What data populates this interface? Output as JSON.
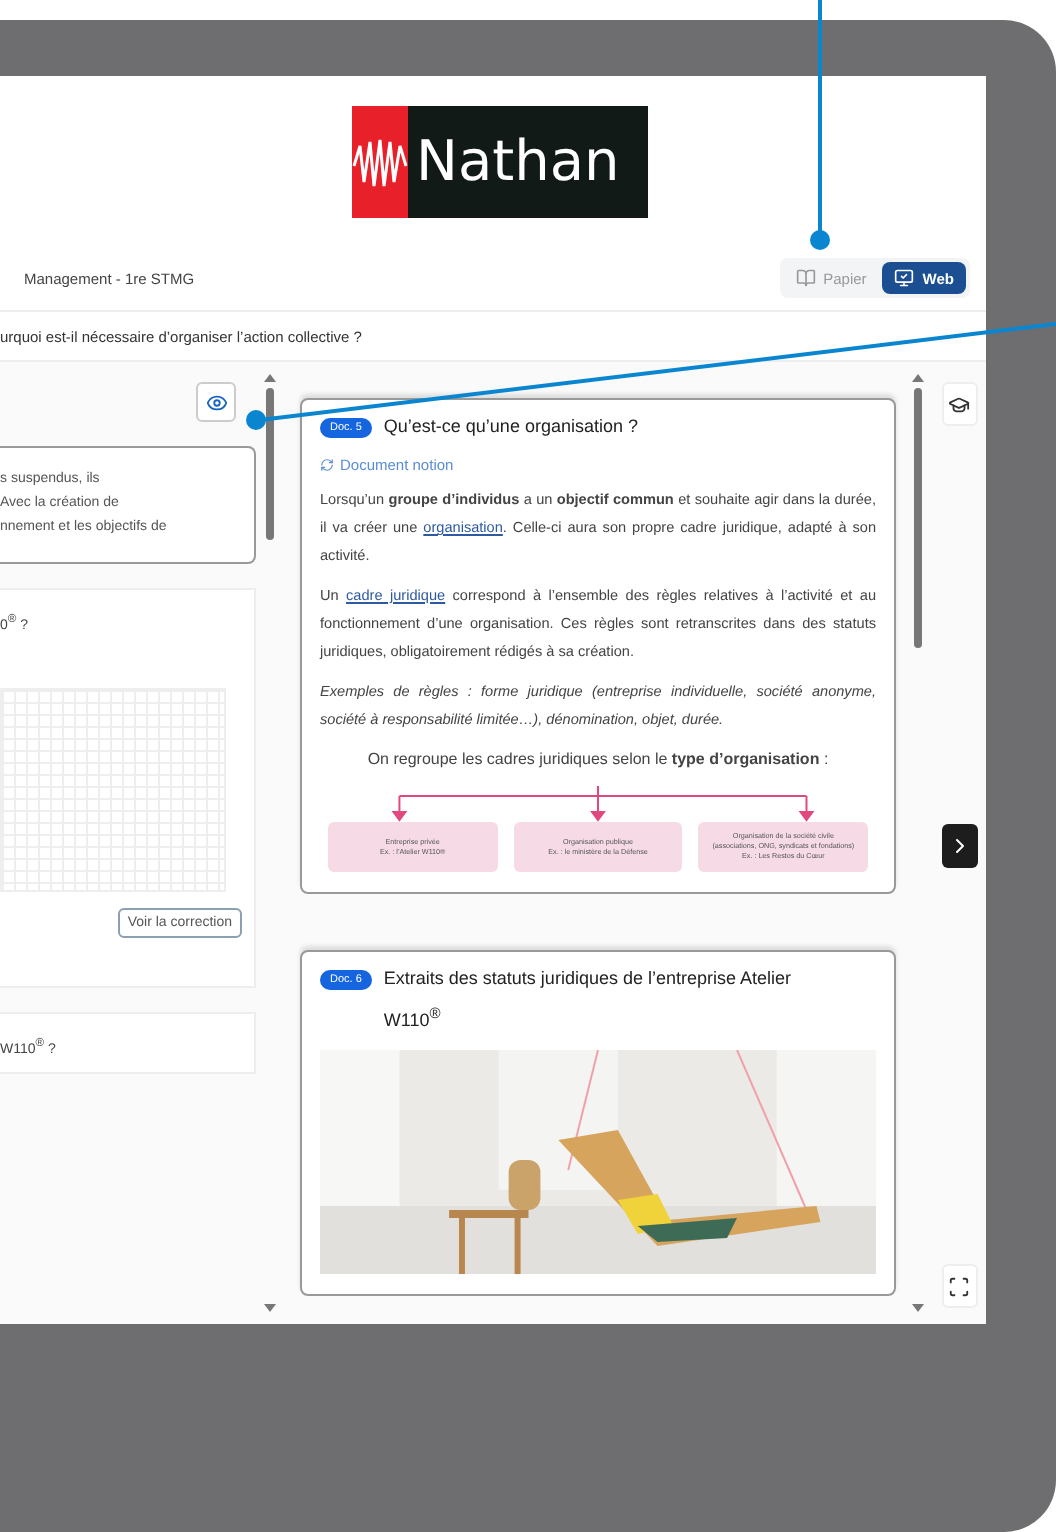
{
  "logo": {
    "text": "Nathan"
  },
  "header": {
    "title": "Management - 1re STMG",
    "modes": [
      {
        "label": "Papier",
        "selected": false
      },
      {
        "label": "Web",
        "selected": true
      }
    ]
  },
  "question": "urquoi est-il nécessaire d’organiser l’action collective ?",
  "left_cards": [
    {
      "kind": "text",
      "lines": [
        "s suspendus, ils",
        "Avec la création de",
        "nnement et les objectifs de"
      ]
    },
    {
      "kind": "exercise",
      "title": "0$^{®}$ ?",
      "button": "Voir la correction"
    },
    {
      "kind": "exercise",
      "title": "W110$^{®}$ ?"
    }
  ],
  "docs": [
    {
      "badge": "Doc. 5",
      "title": "Qu’est-ce qu’une organisation ?",
      "tag": "Document notion",
      "paragraphs": [
        {
          "kind": "body",
          "segments": [
            {
              "kind": "text",
              "text": "Lorsqu’un **groupe d’individus** a un **objectif commun** et souhaite agir dans la durée, il va créer une "
            },
            {
              "kind": "link",
              "text": "organisation"
            },
            {
              "kind": "text",
              "text": ". Celle-ci aura son propre cadre juridique, adapté à son activité."
            }
          ]
        },
        {
          "kind": "body",
          "segments": [
            {
              "kind": "text",
              "text": "Un "
            },
            {
              "kind": "link",
              "text": "cadre juridique"
            },
            {
              "kind": "text",
              "text": " correspond à l’ensemble des règles relatives à l’activité et au fonctionnement d’une organisation. Ces règles sont retranscrites dans des statuts juridiques, obligatoirement rédigés à sa création."
            }
          ]
        },
        {
          "kind": "example",
          "segments": [
            {
              "kind": "text",
              "text": "Exemples de règles : forme juridique (entreprise individuelle, société anonyme, société à responsabilité limitée…), dénomination, objet, durée."
            }
          ]
        },
        {
          "kind": "lead",
          "segments": [
            {
              "kind": "text",
              "text": "On regroupe les cadres juridiques selon le **type d’organisation** :"
            }
          ]
        }
      ],
      "diagram": [
        {
          "lines": [
            "Entreprise privée",
            "Ex. : l’Atelier W110®"
          ]
        },
        {
          "lines": [
            "Organisation publique",
            "Ex. : le ministère de la Défense"
          ]
        },
        {
          "lines": [
            "Organisation de la société civile",
            "(associations, ONG, syndicats et fondations)",
            "Ex. : Les Restos du Cœur"
          ]
        }
      ]
    },
    {
      "badge": "Doc. 6",
      "title": "Extraits des statuts juridiques de l’entreprise Atelier W110$^{®}$"
    }
  ]
}
